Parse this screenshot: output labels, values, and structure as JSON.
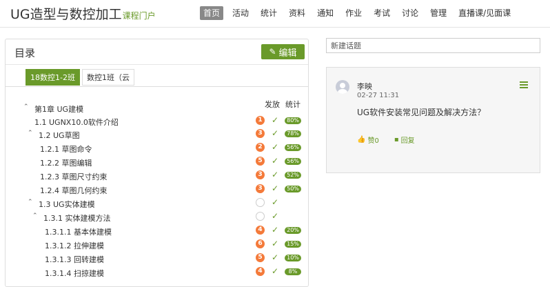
{
  "brand": {
    "title": "UG造型与数控加工",
    "subtitle": "课程门户"
  },
  "nav": [
    {
      "label": "首页",
      "active": true
    },
    {
      "label": "活动"
    },
    {
      "label": "统计"
    },
    {
      "label": "资料"
    },
    {
      "label": "通知"
    },
    {
      "label": "作业"
    },
    {
      "label": "考试"
    },
    {
      "label": "讨论"
    },
    {
      "label": "管理"
    },
    {
      "label": "直播课/见面课"
    }
  ],
  "catalog": {
    "title": "目录",
    "edit_label": "编辑",
    "tabs": [
      {
        "label": "18数控1-2班",
        "active": true
      },
      {
        "label": "数控1班（云"
      }
    ],
    "col_publish": "发放",
    "col_stats": "统计",
    "rows": [
      {
        "num": "",
        "title": "第1章 UG建模",
        "chevron": "⌃",
        "badge": "",
        "check": false,
        "stat": ""
      },
      {
        "num": "1.1",
        "title": "UGNX10.0软件介绍",
        "chevron": "",
        "badge": "1",
        "check": true,
        "stat": "80%"
      },
      {
        "num": "1.2",
        "title": "UG草图",
        "chevron": "⌃",
        "badge": "3",
        "check": true,
        "stat": "78%"
      },
      {
        "num": "1.2.1",
        "title": "草图命令",
        "chevron": "",
        "badge": "2",
        "check": true,
        "stat": "56%"
      },
      {
        "num": "1.2.2",
        "title": "草图编辑",
        "chevron": "",
        "badge": "5",
        "check": true,
        "stat": "56%"
      },
      {
        "num": "1.2.3",
        "title": "草图尺寸约束",
        "chevron": "",
        "badge": "3",
        "check": true,
        "stat": "52%"
      },
      {
        "num": "1.2.4",
        "title": "草图几何约束",
        "chevron": "",
        "badge": "3",
        "check": true,
        "stat": "50%"
      },
      {
        "num": "1.3",
        "title": "UG实体建模",
        "chevron": "⌃",
        "badge": "",
        "check": true,
        "stat": ""
      },
      {
        "num": "1.3.1",
        "title": "实体建模方法",
        "chevron": "⌃",
        "badge": "",
        "check": true,
        "stat": ""
      },
      {
        "num": "1.3.1.1",
        "title": "基本体建模",
        "chevron": "",
        "badge": "4",
        "check": true,
        "stat": "20%"
      },
      {
        "num": "1.3.1.2",
        "title": "拉伸建模",
        "chevron": "",
        "badge": "6",
        "check": true,
        "stat": "15%"
      },
      {
        "num": "1.3.1.3",
        "title": "回转建模",
        "chevron": "",
        "badge": "5",
        "check": true,
        "stat": "10%"
      },
      {
        "num": "1.3.1.4",
        "title": "扫掠建模",
        "chevron": "",
        "badge": "4",
        "check": true,
        "stat": "8%"
      }
    ]
  },
  "discussion": {
    "new_topic_placeholder": "新建话题",
    "topic": {
      "author": "李映",
      "time": "02-27 11:31",
      "text": "UG软件安装常见问题及解决方法？",
      "like_label": "赞0",
      "reply_label": "回复"
    }
  },
  "colors": {
    "accent": "#6a9a2a",
    "badge": "#f47a3a",
    "nav_active": "#888888"
  }
}
